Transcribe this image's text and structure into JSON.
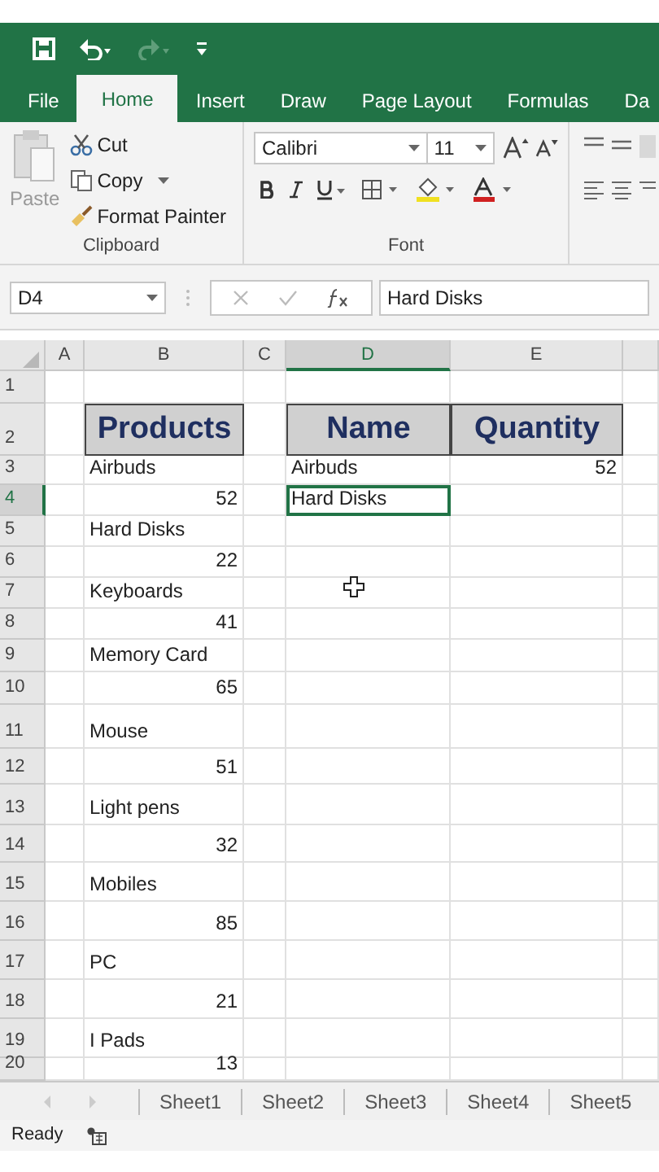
{
  "ribbon_tabs": [
    {
      "label": "File",
      "selected": false
    },
    {
      "label": "Home",
      "selected": true
    },
    {
      "label": "Insert",
      "selected": false
    },
    {
      "label": "Draw",
      "selected": false
    },
    {
      "label": "Page Layout",
      "selected": false
    },
    {
      "label": "Formulas",
      "selected": false
    },
    {
      "label": "Da",
      "selected": false
    }
  ],
  "clipboard": {
    "paste": "Paste",
    "cut": "Cut",
    "copy": "Copy",
    "format_painter": "Format Painter",
    "group_label": "Clipboard"
  },
  "font": {
    "font_name": "Calibri",
    "font_size": "11",
    "group_label": "Font"
  },
  "formula_bar": {
    "name_box": "D4",
    "formula": "Hard Disks"
  },
  "columns": [
    {
      "label": "A",
      "selected": false
    },
    {
      "label": "B",
      "selected": false
    },
    {
      "label": "C",
      "selected": false
    },
    {
      "label": "D",
      "selected": true
    },
    {
      "label": "E",
      "selected": false
    }
  ],
  "rows": [
    {
      "number": "1",
      "selected": false
    },
    {
      "number": "2",
      "selected": false,
      "cells": [
        null,
        {
          "text": "Products",
          "kind": "header",
          "selected": false
        },
        null,
        {
          "text": "Name",
          "kind": "header",
          "selected": false
        },
        {
          "text": "Quantity",
          "kind": "header",
          "selected": false
        }
      ]
    },
    {
      "number": "3",
      "selected": false,
      "cells": [
        null,
        {
          "text": "Airbuds",
          "kind": "text",
          "selected": false
        },
        null,
        {
          "text": "Airbuds",
          "kind": "text",
          "selected": false
        },
        {
          "text": "52",
          "kind": "number",
          "selected": false
        }
      ]
    },
    {
      "number": "4",
      "selected": true,
      "cells": [
        null,
        {
          "text": "52",
          "kind": "number",
          "selected": false
        },
        null,
        {
          "text": "Hard Disks",
          "kind": "text",
          "selected": true
        }
      ]
    },
    {
      "number": "5",
      "selected": false,
      "cells": [
        null,
        {
          "text": "Hard Disks",
          "kind": "text",
          "selected": false
        }
      ]
    },
    {
      "number": "6",
      "selected": false,
      "cells": [
        null,
        {
          "text": "22",
          "kind": "number",
          "selected": false
        }
      ]
    },
    {
      "number": "7",
      "selected": false,
      "cells": [
        null,
        {
          "text": "Keyboards",
          "kind": "text",
          "selected": false
        }
      ]
    },
    {
      "number": "8",
      "selected": false,
      "cells": [
        null,
        {
          "text": "41",
          "kind": "number",
          "selected": false
        }
      ]
    },
    {
      "number": "9",
      "selected": false,
      "cells": [
        null,
        {
          "text": "Memory Card",
          "kind": "text",
          "selected": false
        }
      ]
    },
    {
      "number": "10",
      "selected": false,
      "cells": [
        null,
        {
          "text": "65",
          "kind": "number",
          "selected": false
        }
      ]
    },
    {
      "number": "11",
      "selected": false,
      "cells": [
        null,
        {
          "text": "Mouse",
          "kind": "text",
          "selected": false
        }
      ]
    },
    {
      "number": "12",
      "selected": false,
      "cells": [
        null,
        {
          "text": "51",
          "kind": "number",
          "selected": false
        }
      ]
    },
    {
      "number": "13",
      "selected": false,
      "cells": [
        null,
        {
          "text": "Light pens",
          "kind": "text",
          "selected": false
        }
      ]
    },
    {
      "number": "14",
      "selected": false,
      "cells": [
        null,
        {
          "text": "32",
          "kind": "number",
          "selected": false
        }
      ]
    },
    {
      "number": "15",
      "selected": false,
      "cells": [
        null,
        {
          "text": "Mobiles",
          "kind": "text",
          "selected": false
        }
      ]
    },
    {
      "number": "16",
      "selected": false,
      "cells": [
        null,
        {
          "text": "85",
          "kind": "number",
          "selected": false
        }
      ]
    },
    {
      "number": "17",
      "selected": false,
      "cells": [
        null,
        {
          "text": "PC",
          "kind": "text",
          "selected": false
        }
      ]
    },
    {
      "number": "18",
      "selected": false,
      "cells": [
        null,
        {
          "text": "21",
          "kind": "number",
          "selected": false
        }
      ]
    },
    {
      "number": "19",
      "selected": false,
      "cells": [
        null,
        {
          "text": "I Pads",
          "kind": "text",
          "selected": false
        }
      ]
    },
    {
      "number": "20",
      "selected": false,
      "cells": [
        null,
        {
          "text": "13",
          "kind": "number",
          "selected": false
        }
      ]
    }
  ],
  "sheet_tabs": [
    {
      "label": "Sheet1",
      "selected": false
    },
    {
      "label": "Sheet2",
      "selected": false
    },
    {
      "label": "Sheet3",
      "selected": false
    },
    {
      "label": "Sheet4",
      "selected": false
    },
    {
      "label": "Sheet5",
      "selected": false
    }
  ],
  "status_bar": {
    "text": "Ready"
  }
}
